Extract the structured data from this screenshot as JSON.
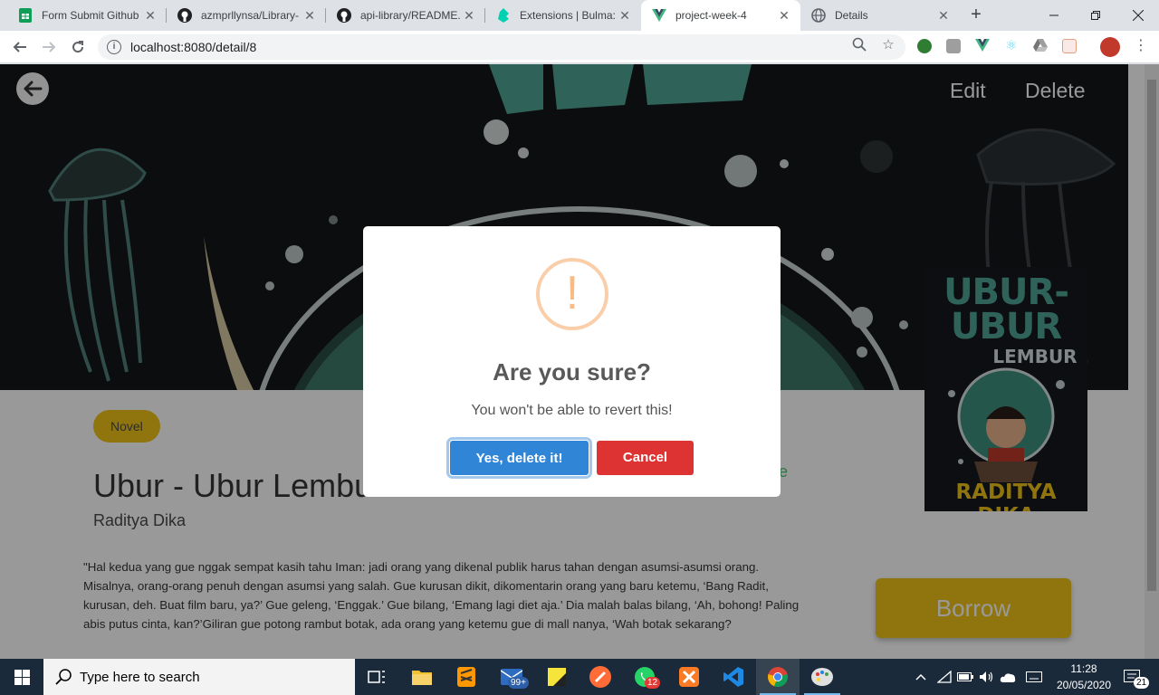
{
  "browser": {
    "tabs": [
      {
        "title": "Form Submit Github",
        "icon": "google-sheets-icon",
        "active": false
      },
      {
        "title": "azmprllynsa/Library-",
        "icon": "github-icon",
        "active": false
      },
      {
        "title": "api-library/README.",
        "icon": "github-icon",
        "active": false
      },
      {
        "title": "Extensions | Bulma: F",
        "icon": "bulma-icon",
        "active": false
      },
      {
        "title": "project-week-4",
        "icon": "vue-icon",
        "active": true
      },
      {
        "title": "Details",
        "icon": "globe-icon",
        "active": false
      }
    ],
    "url": "localhost:8080/detail/8"
  },
  "page": {
    "hero": {
      "edit_label": "Edit",
      "delete_label": "Delete"
    },
    "genre": "Novel",
    "title": "Ubur - Ubur Lembur",
    "author": "Raditya Dika",
    "status_fragment": "e",
    "description": "\"Hal kedua yang gue nggak sempat kasih tahu Iman: jadi orang yang dikenal publik harus tahan dengan asumsi-asumsi orang. Misalnya, orang-orang penuh dengan asumsi yang salah. Gue kurusan dikit, dikomentarin orang yang baru ketemu, ‘Bang Radit, kurusan, deh. Buat film baru, ya?’ Gue geleng, ‘Enggak.’ Gue bilang, ‘Emang lagi diet aja.’ Dia malah balas bilang, ‘Ah, bohong! Paling abis putus cinta, kan?’Giliran gue potong rambut botak, ada orang yang ketemu gue di mall nanya, ‘Wah botak sekarang?",
    "borrow_label": "Borrow",
    "cover": {
      "title_line1": "UBUR-",
      "title_line2": "UBUR",
      "title_line3": "LEMBUR",
      "author": "RADITYA DIKA"
    }
  },
  "modal": {
    "icon_glyph": "!",
    "title": "Are you sure?",
    "text": "You won't be able to revert this!",
    "confirm_label": "Yes, delete it!",
    "cancel_label": "Cancel"
  },
  "taskbar": {
    "search_placeholder": "Type here to search",
    "time": "11:28",
    "date": "20/05/2020",
    "mail_badge": "99+",
    "whatsapp_badge": "12",
    "notification_count": "21"
  },
  "colors": {
    "confirm": "#3085d6",
    "cancel": "#dd3333",
    "accent_yellow": "#f0c419",
    "warning": "#f8bb86"
  }
}
